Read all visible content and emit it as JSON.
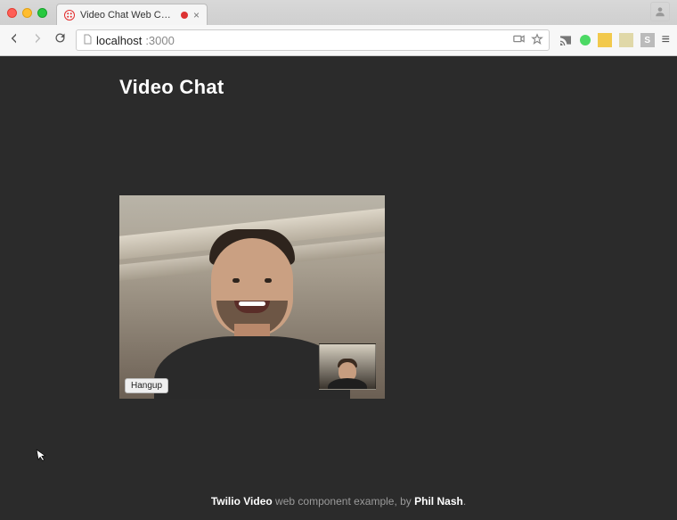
{
  "browser": {
    "tab": {
      "title": "Video Chat Web Compo",
      "favicon_name": "twilio-icon",
      "recording_indicator": true
    },
    "omnibox": {
      "host": "localhost",
      "path": ":3000"
    }
  },
  "page": {
    "heading": "Video Chat",
    "hangup_label": "Hangup"
  },
  "footer": {
    "brand": "Twilio Video",
    "middle_text": " web component example, by ",
    "author": "Phil Nash",
    "suffix": "."
  }
}
